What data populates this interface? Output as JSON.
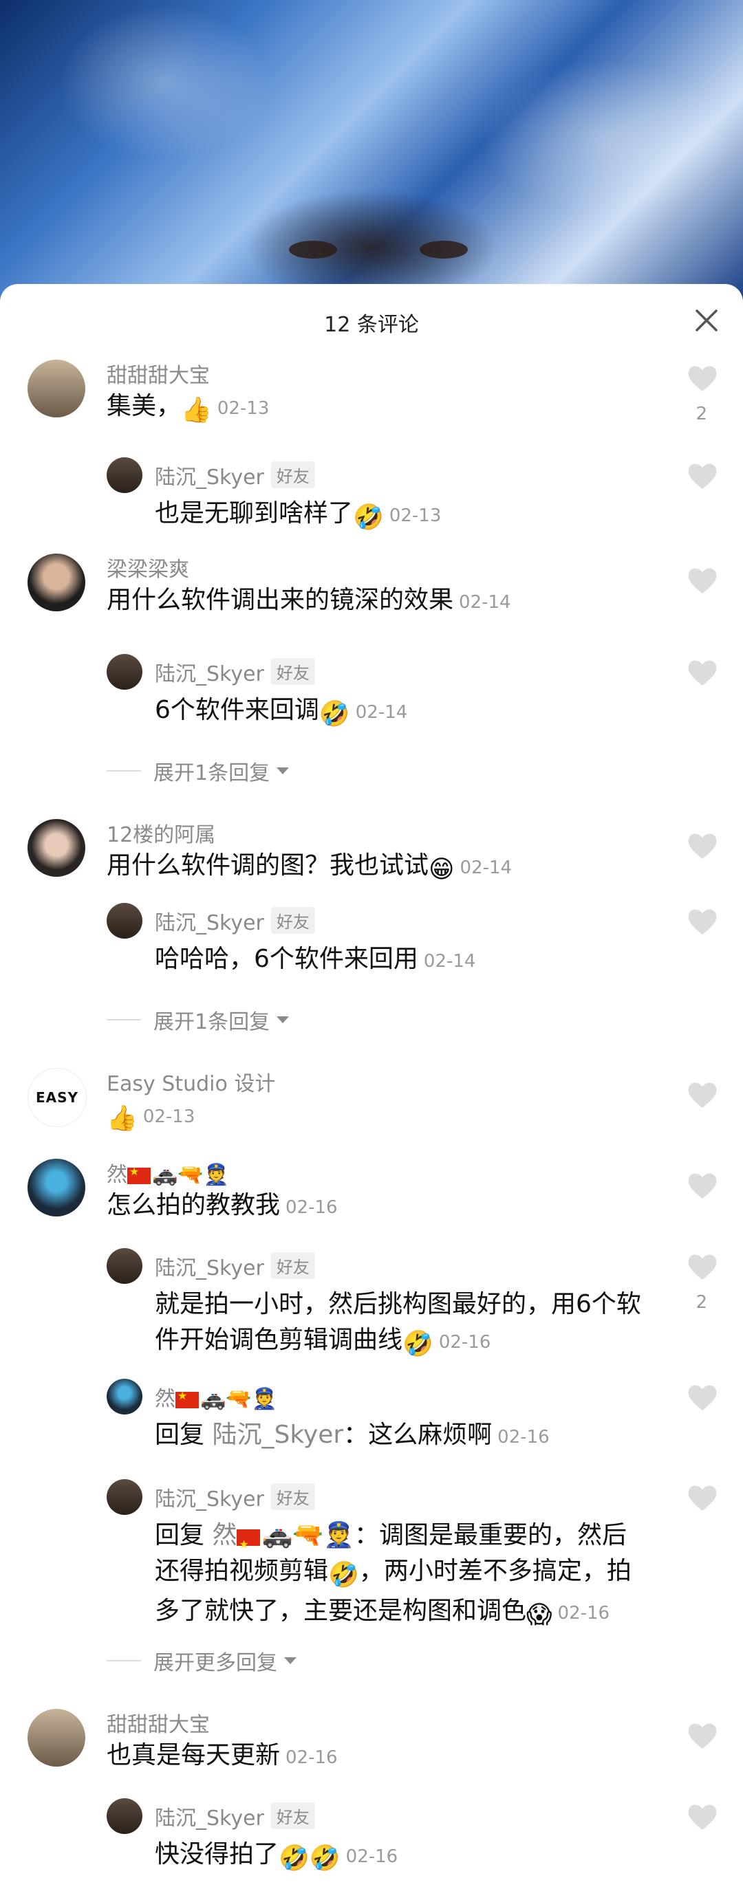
{
  "sheet": {
    "title": "12 条评论"
  },
  "icons": {
    "close": "close-icon",
    "like": "heart-outline-icon",
    "expand": "chevron-down-icon"
  },
  "comments": [
    {
      "name": "甜甜甜大宝",
      "text": "集美，",
      "emoji": "👍",
      "date": "02-13",
      "likes": "2",
      "avatar": "甜"
    },
    {
      "name": "陆沉_Skyer",
      "badge": "好友",
      "text": "也是无聊到啥样了",
      "emoji": "🤣",
      "date": "02-13",
      "avatar": "陆"
    },
    {
      "name": "梁梁梁爽",
      "text": "用什么软件调出来的镜深的效果",
      "date": "02-14",
      "avatar": "梁"
    },
    {
      "name": "陆沉_Skyer",
      "badge": "好友",
      "text": "6个软件来回调",
      "emoji": "🤣",
      "date": "02-14",
      "avatar": "陆"
    },
    {
      "expand": "展开1条回复"
    },
    {
      "name": "12楼的阿属",
      "text": "用什么软件调的图？我也试试",
      "emoji": "😁",
      "date": "02-14",
      "avatar": "12"
    },
    {
      "name": "陆沉_Skyer",
      "badge": "好友",
      "text": "哈哈哈，6个软件来回用",
      "date": "02-14",
      "avatar": "陆"
    },
    {
      "expand": "展开1条回复"
    },
    {
      "name": "Easy Studio  设计",
      "text": "",
      "emoji": "👍",
      "date": "02-13",
      "avatar": "EASY"
    },
    {
      "name": "然",
      "nameEmoji": "🚓🔫👮",
      "text": "怎么拍的教教我",
      "date": "02-16",
      "avatar": "然"
    },
    {
      "name": "陆沉_Skyer",
      "badge": "好友",
      "text_line1": "就是拍一小时，然后挑构图最好的，用6个软",
      "text_line2": "件开始调色剪辑调曲线",
      "emoji": "🤣",
      "date": "02-16",
      "likes": "2",
      "avatar": "陆"
    },
    {
      "name": "然",
      "nameEmoji": "🚓🔫👮",
      "reply_prefix": "回复",
      "reply_to": "陆沉_Skyer",
      "text": "：这么麻烦啊",
      "date": "02-16",
      "avatar": "然"
    },
    {
      "name": "陆沉_Skyer",
      "badge": "好友",
      "reply_prefix": "回复",
      "reply_to": "然",
      "reply_to_emoji": "🚓🔫👮",
      "text_line1": "：调图是最重要的，然后",
      "text_line2": "还得拍视频剪辑",
      "emoji2": "🤣",
      "text_line2b": "，两小时差不多搞定，拍",
      "text_line3": "多了就快了，主要还是构图和调色",
      "emoji3": "😱",
      "date": "02-16",
      "avatar": "陆"
    },
    {
      "expand": "展开更多回复"
    },
    {
      "name": "甜甜甜大宝",
      "text": "也真是每天更新",
      "date": "02-16",
      "avatar": "甜"
    },
    {
      "name": "陆沉_Skyer",
      "badge": "好友",
      "text": "快没得拍了",
      "emoji": "🤣🤣",
      "date": "02-16",
      "avatar": "陆"
    }
  ],
  "colors": {
    "name": "#8a8a8a",
    "text": "#111111",
    "meta": "#9a9a9a",
    "heart": "#dcdcdc"
  }
}
